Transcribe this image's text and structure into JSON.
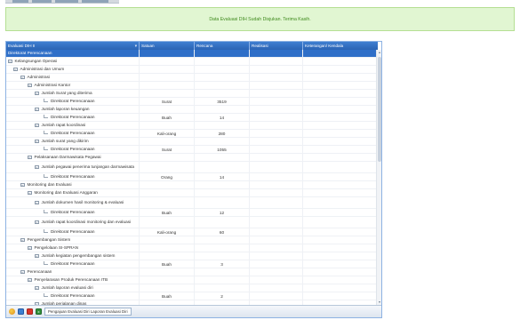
{
  "banner": {
    "message": "Data Evaluasi DIH Sudah Disjukan. Terima Kasih."
  },
  "grid": {
    "columns": [
      "Evaluasi DIH II",
      "Satuan",
      "Rencana",
      "Realisasi",
      "Keterangan/ Kendala"
    ],
    "rows": [
      {
        "label": "Direktorat Perencanaan",
        "level": 0,
        "type": "root",
        "selected": true,
        "satuan": "",
        "rencana": ""
      },
      {
        "label": "Kelangsungan Operasi",
        "level": 0,
        "type": "node",
        "satuan": "",
        "rencana": ""
      },
      {
        "label": "Administrasi dan Umum",
        "level": 1,
        "type": "node",
        "satuan": "",
        "rencana": ""
      },
      {
        "label": "Administrasi",
        "level": 2,
        "type": "node",
        "satuan": "",
        "rencana": ""
      },
      {
        "label": "Administrasi Kantor",
        "level": 3,
        "type": "node",
        "satuan": "",
        "rencana": ""
      },
      {
        "label": "Jumlah Surat yang diterima",
        "level": 4,
        "type": "node",
        "satuan": "",
        "rencana": ""
      },
      {
        "label": "Direktorat Perencanaan",
        "level": 5,
        "type": "leaf",
        "satuan": "Surat",
        "rencana": "3519"
      },
      {
        "label": "Jumlah laporan keuangan",
        "level": 4,
        "type": "node",
        "satuan": "",
        "rencana": ""
      },
      {
        "label": "Direktorat Perencanaan",
        "level": 5,
        "type": "leaf",
        "satuan": "Buah",
        "rencana": "14"
      },
      {
        "label": "Jumlah rapat koordinasi",
        "level": 4,
        "type": "node",
        "satuan": "",
        "rencana": ""
      },
      {
        "label": "Direktorat Perencanaan",
        "level": 5,
        "type": "leaf",
        "satuan": "Kali-orang",
        "rencana": "280"
      },
      {
        "label": "Jumlah surat yang dikirim",
        "level": 4,
        "type": "node",
        "satuan": "",
        "rencana": ""
      },
      {
        "label": "Direktorat Perencanaan",
        "level": 5,
        "type": "leaf",
        "satuan": "Surat",
        "rencana": "1055"
      },
      {
        "label": "Pelaksanaan Darmawisata Pegawai",
        "level": 3,
        "type": "node",
        "satuan": "",
        "rencana": ""
      },
      {
        "label": "Jumlah pegawai penerima tunjangan darmawisata",
        "level": 4,
        "type": "node",
        "lines": 2,
        "satuan": "",
        "rencana": ""
      },
      {
        "label": "Direktorat Perencanaan",
        "level": 5,
        "type": "leaf",
        "satuan": "Orang",
        "rencana": "14"
      },
      {
        "label": "Monitoring dan Evaluasi",
        "level": 2,
        "type": "node",
        "satuan": "",
        "rencana": ""
      },
      {
        "label": "Monitoring dan Evaluasi Anggaran",
        "level": 3,
        "type": "node",
        "satuan": "",
        "rencana": ""
      },
      {
        "label": "Jumlah dokumen hasil monitoring & evaluasi",
        "level": 4,
        "type": "node",
        "lines": 2,
        "satuan": "",
        "rencana": ""
      },
      {
        "label": "Direktorat Perencanaan",
        "level": 5,
        "type": "leaf",
        "satuan": "Buah",
        "rencana": "12"
      },
      {
        "label": "Jumlah rapat koordinasi monitoring dan evaluasi",
        "level": 4,
        "type": "node",
        "lines": 2,
        "satuan": "",
        "rencana": ""
      },
      {
        "label": "Direktorat Perencanaan",
        "level": 5,
        "type": "leaf",
        "satuan": "Kali-orang",
        "rencana": "60"
      },
      {
        "label": "Pengembangan Sistem",
        "level": 2,
        "type": "node",
        "satuan": "",
        "rencana": ""
      },
      {
        "label": "Pengelolaan SI-SPRAN",
        "level": 3,
        "type": "node",
        "satuan": "",
        "rencana": ""
      },
      {
        "label": "Jumlah kegiatan pengembangan sistem",
        "level": 4,
        "type": "node",
        "satuan": "",
        "rencana": ""
      },
      {
        "label": "Direktorat Perencanaan",
        "level": 5,
        "type": "leaf",
        "satuan": "Buah",
        "rencana": "3"
      },
      {
        "label": "Perencanaan",
        "level": 2,
        "type": "node",
        "satuan": "",
        "rencana": ""
      },
      {
        "label": "Penyelarasan Produk Perencanaan ITB",
        "level": 3,
        "type": "node",
        "satuan": "",
        "rencana": ""
      },
      {
        "label": "Jumlah laporan evaluasi diri",
        "level": 4,
        "type": "node",
        "satuan": "",
        "rencana": ""
      },
      {
        "label": "Direktorat Perencanaan",
        "level": 5,
        "type": "leaf",
        "satuan": "Buah",
        "rencana": "2"
      },
      {
        "label": "Jumlah perjalanan dinas",
        "level": 4,
        "type": "node",
        "satuan": "",
        "rencana": ""
      }
    ]
  },
  "toolbar": {
    "icons": [
      "refresh-icon",
      "save-icon",
      "pdf-icon",
      "excel-icon"
    ],
    "button_label": "Pengajuan Evaluasi Diri Laporan Evaluasi Diri"
  }
}
